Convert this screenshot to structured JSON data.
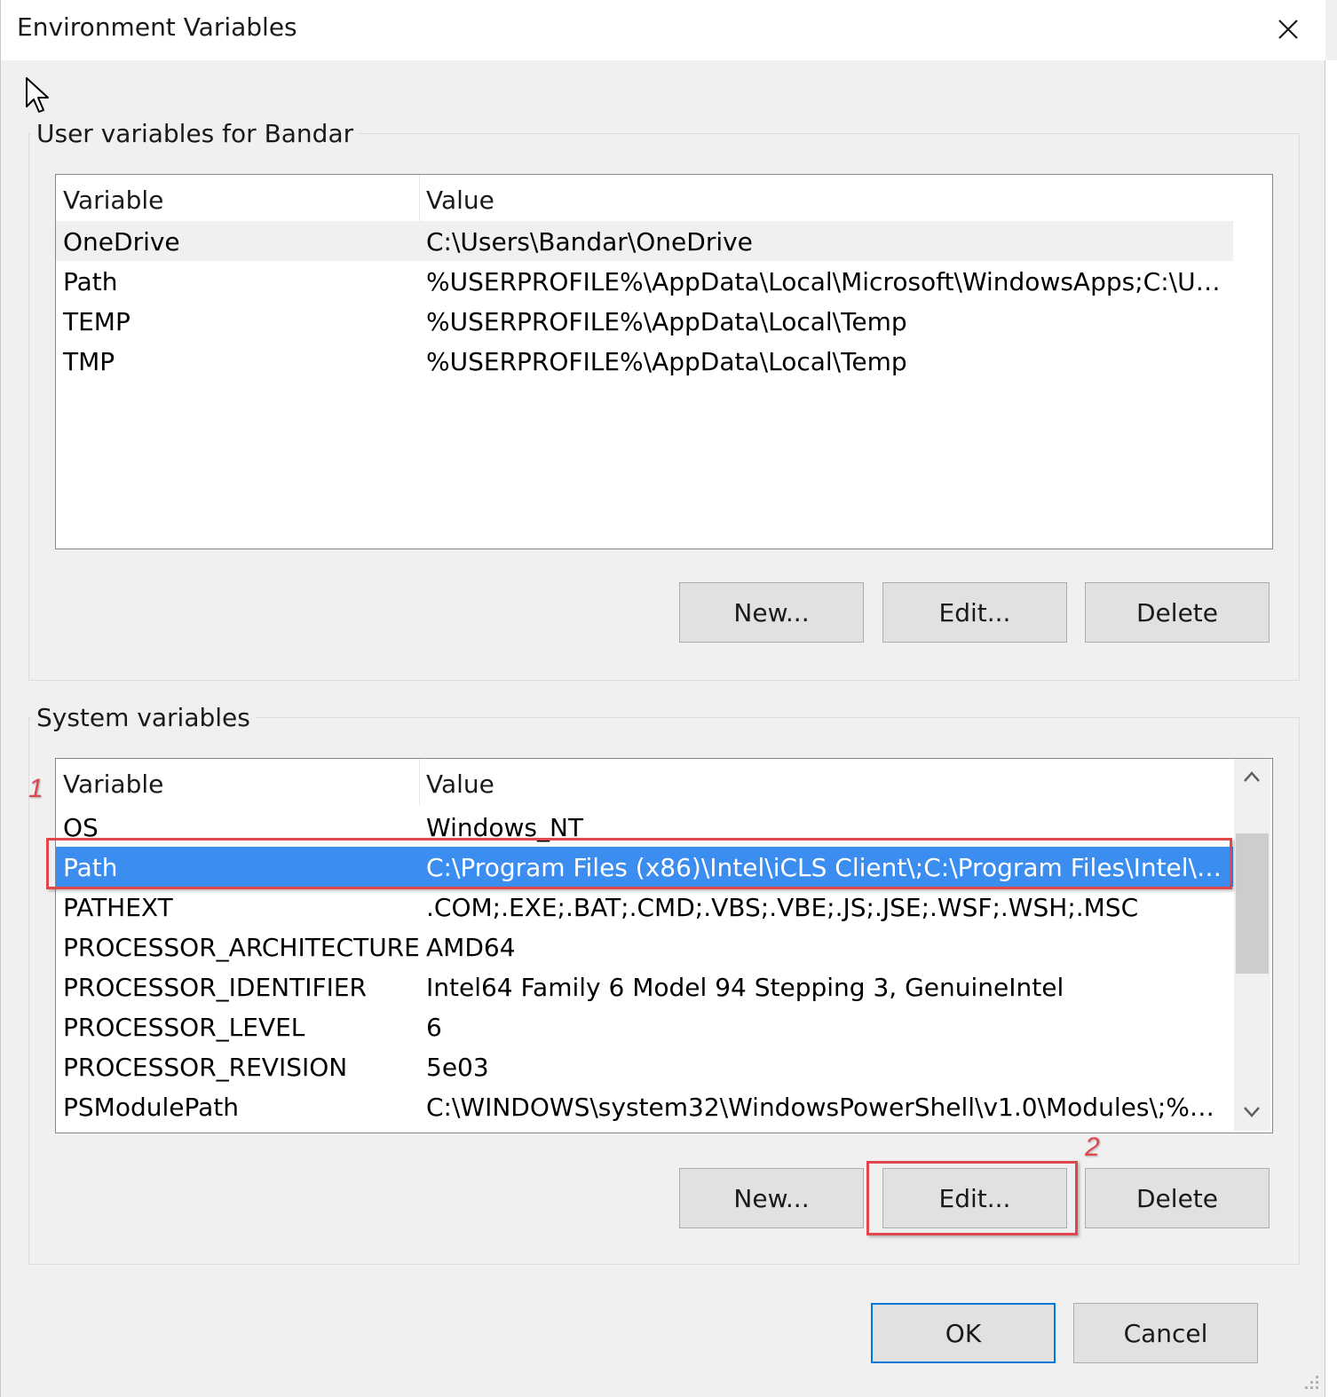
{
  "window": {
    "title": "Environment Variables"
  },
  "user_vars": {
    "legend": "User variables for Bandar",
    "columns": {
      "variable": "Variable",
      "value": "Value"
    },
    "rows": [
      {
        "variable": "OneDrive",
        "value": "C:\\Users\\Bandar\\OneDrive"
      },
      {
        "variable": "Path",
        "value": "%USERPROFILE%\\AppData\\Local\\Microsoft\\WindowsApps;C:\\User..."
      },
      {
        "variable": "TEMP",
        "value": "%USERPROFILE%\\AppData\\Local\\Temp"
      },
      {
        "variable": "TMP",
        "value": "%USERPROFILE%\\AppData\\Local\\Temp"
      }
    ],
    "buttons": {
      "new": "New...",
      "edit": "Edit...",
      "delete": "Delete"
    }
  },
  "system_vars": {
    "legend": "System variables",
    "columns": {
      "variable": "Variable",
      "value": "Value"
    },
    "rows": [
      {
        "variable": "OS",
        "value": "Windows_NT"
      },
      {
        "variable": "Path",
        "value": "C:\\Program Files (x86)\\Intel\\iCLS Client\\;C:\\Program Files\\Intel\\iCLS..."
      },
      {
        "variable": "PATHEXT",
        "value": ".COM;.EXE;.BAT;.CMD;.VBS;.VBE;.JS;.JSE;.WSF;.WSH;.MSC"
      },
      {
        "variable": "PROCESSOR_ARCHITECTURE",
        "value": "AMD64"
      },
      {
        "variable": "PROCESSOR_IDENTIFIER",
        "value": "Intel64 Family 6 Model 94 Stepping 3, GenuineIntel"
      },
      {
        "variable": "PROCESSOR_LEVEL",
        "value": "6"
      },
      {
        "variable": "PROCESSOR_REVISION",
        "value": "5e03"
      },
      {
        "variable": "PSModulePath",
        "value": "C:\\WINDOWS\\system32\\WindowsPowerShell\\v1.0\\Modules\\;%Pro..."
      }
    ],
    "buttons": {
      "new": "New...",
      "edit": "Edit...",
      "delete": "Delete"
    }
  },
  "footer": {
    "ok": "OK",
    "cancel": "Cancel"
  },
  "annotations": {
    "step1": "1",
    "step2": "2"
  },
  "colors": {
    "selection": "#3c8df0",
    "annotation": "#e0474c",
    "default_button_border": "#0078d7"
  },
  "icons": {
    "close": "close-icon",
    "cursor": "cursor-icon",
    "scroll_up": "chevron-up-icon",
    "scroll_down": "chevron-down-icon"
  }
}
